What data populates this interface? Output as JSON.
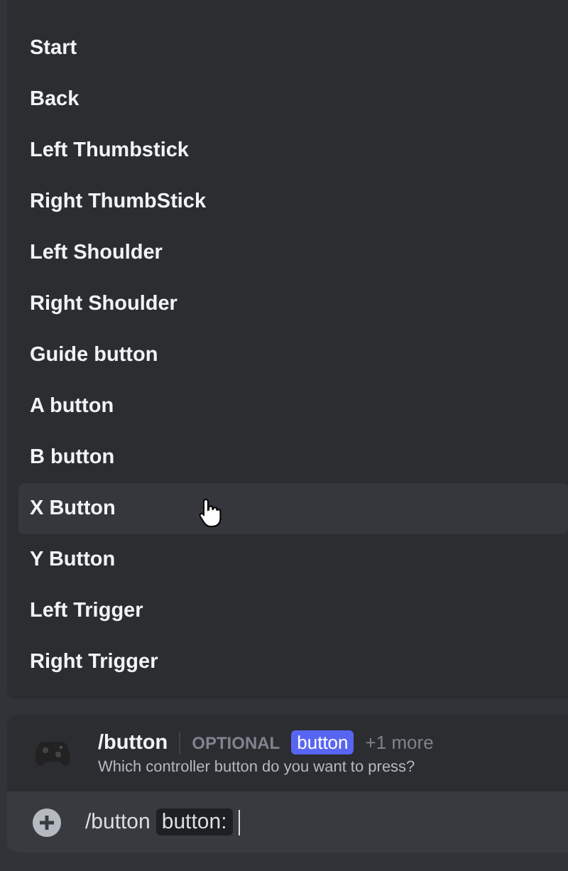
{
  "options": [
    {
      "label": "Start",
      "selected": false
    },
    {
      "label": "Back",
      "selected": false
    },
    {
      "label": "Left Thumbstick",
      "selected": false
    },
    {
      "label": "Right ThumbStick",
      "selected": false
    },
    {
      "label": "Left Shoulder",
      "selected": false
    },
    {
      "label": "Right Shoulder",
      "selected": false
    },
    {
      "label": "Guide button",
      "selected": false
    },
    {
      "label": "A button",
      "selected": false
    },
    {
      "label": "B button",
      "selected": false
    },
    {
      "label": "X Button",
      "selected": true
    },
    {
      "label": "Y Button",
      "selected": false
    },
    {
      "label": "Left Trigger",
      "selected": false
    },
    {
      "label": "Right Trigger",
      "selected": false
    }
  ],
  "command": {
    "name": "/button",
    "optional_label": "OPTIONAL",
    "option_tag": "button",
    "more": "+1 more",
    "description": "Which controller button do you want to press?"
  },
  "input": {
    "command": "/button",
    "option_chip": "button:"
  }
}
